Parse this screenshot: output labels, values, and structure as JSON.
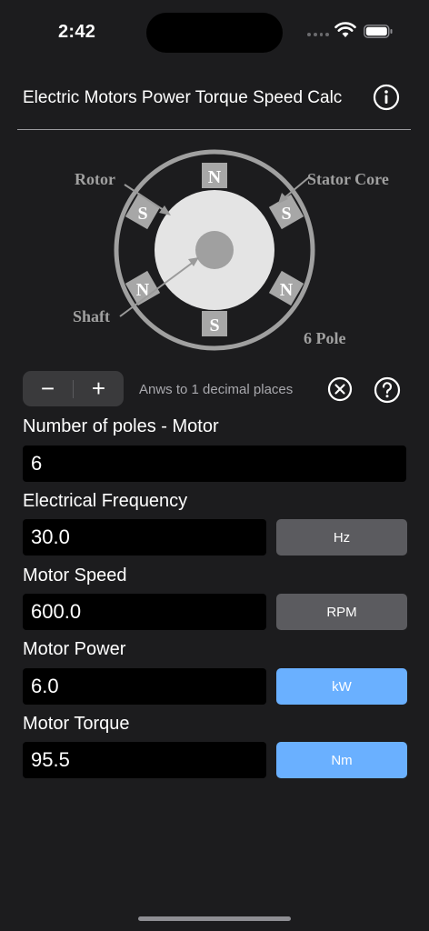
{
  "status": {
    "time": "2:42"
  },
  "header": {
    "title": "Electric Motors Power Torque Speed Calc"
  },
  "diagram": {
    "labels": {
      "rotor": "Rotor",
      "stator": "Stator Core",
      "shaft": "Shaft",
      "pole_count": "6 Pole"
    },
    "poles": {
      "top": "N",
      "upper_left": "S",
      "upper_right": "S",
      "lower_left": "N",
      "lower_right": "N",
      "bottom": "S"
    }
  },
  "controls": {
    "minus": "−",
    "plus": "+",
    "decimal_note": "Anws to 1 decimal places"
  },
  "fields": {
    "poles": {
      "label": "Number of poles - Motor",
      "value": "6"
    },
    "frequency": {
      "label": "Electrical Frequency",
      "value": "30.0",
      "unit": "Hz"
    },
    "speed": {
      "label": "Motor Speed",
      "value": "600.0",
      "unit": "RPM"
    },
    "power": {
      "label": "Motor Power",
      "value": "6.0",
      "unit": "kW"
    },
    "torque": {
      "label": "Motor Torque",
      "value": "95.5",
      "unit": "Nm"
    }
  },
  "colors": {
    "background": "#1c1c1e",
    "accent": "#6ab0ff",
    "unit_grey": "#5b5b5f",
    "field_bg": "#000000"
  }
}
